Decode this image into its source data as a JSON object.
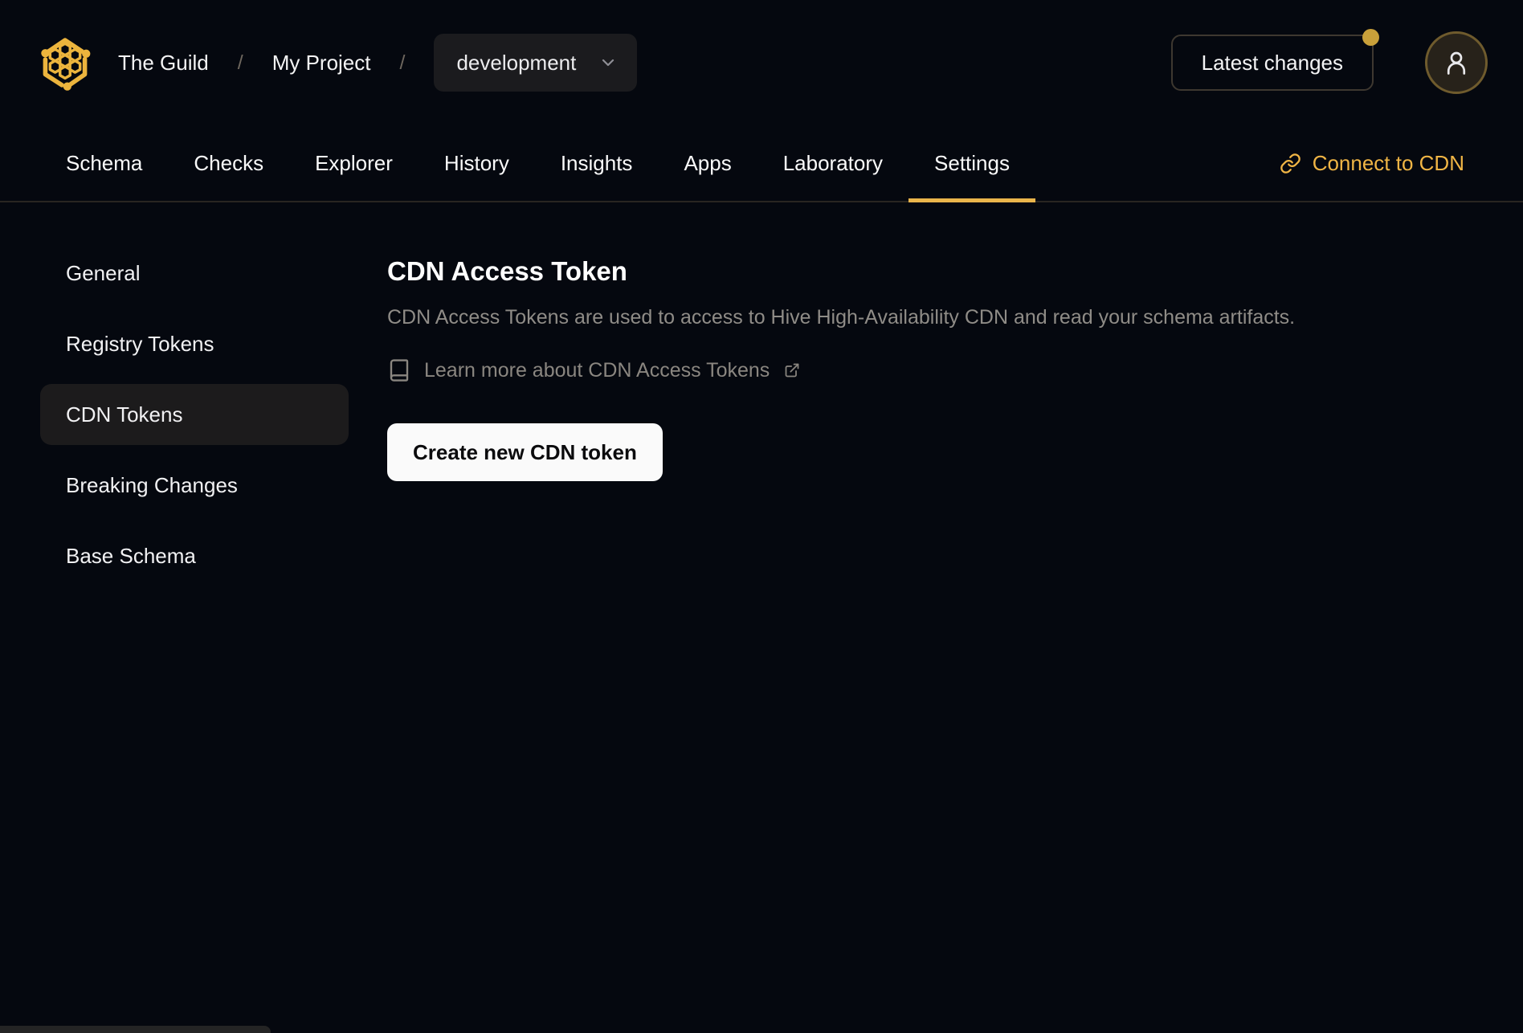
{
  "brand": {
    "org": "The Guild",
    "project": "My Project",
    "target": "development",
    "separator": "/"
  },
  "header": {
    "latest_changes_label": "Latest changes",
    "notification_dot": true
  },
  "tabs": [
    {
      "label": "Schema",
      "active": false
    },
    {
      "label": "Checks",
      "active": false
    },
    {
      "label": "Explorer",
      "active": false
    },
    {
      "label": "History",
      "active": false
    },
    {
      "label": "Insights",
      "active": false
    },
    {
      "label": "Apps",
      "active": false
    },
    {
      "label": "Laboratory",
      "active": false
    },
    {
      "label": "Settings",
      "active": true
    }
  ],
  "connect_cdn": {
    "label": "Connect to CDN"
  },
  "sidebar": {
    "items": [
      {
        "label": "General",
        "active": false
      },
      {
        "label": "Registry Tokens",
        "active": false
      },
      {
        "label": "CDN Tokens",
        "active": true
      },
      {
        "label": "Breaking Changes",
        "active": false
      },
      {
        "label": "Base Schema",
        "active": false
      }
    ]
  },
  "main": {
    "title": "CDN Access Token",
    "description": "CDN Access Tokens are used to access to Hive High-Availability CDN and read your schema artifacts.",
    "learn_more_label": "Learn more about CDN Access Tokens",
    "create_button_label": "Create new CDN token"
  },
  "icons": {
    "logo-icon": "hive-hexagon-honeycomb",
    "chevron-down-icon": "chevron-down",
    "notification-dot": "gold-dot-badge",
    "user-icon": "person-outline",
    "link-icon": "chain-link",
    "book-icon": "book",
    "external-link-icon": "arrow-out-of-box"
  },
  "colors": {
    "page_bg": "#05080f",
    "gold": "#ecb43d",
    "gold_bright": "#f0b545",
    "underline": "#eab54b",
    "dot": "#c9a03a",
    "avatar_ring": "#6f5b2d",
    "surface": "#1b1b1e",
    "active_item": "#1c1b1c",
    "border": "#3e3830",
    "divider": "#292521",
    "text_primary": "#f4f4f5",
    "text_muted": "#8f8c87",
    "button_bg": "#fafafa",
    "button_text": "#0b0b0d",
    "toast": "#242424"
  }
}
